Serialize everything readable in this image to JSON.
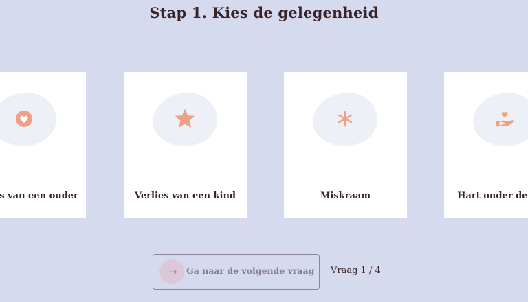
{
  "header": {
    "title": "Stap 1. Kies de gelegenheid"
  },
  "options": [
    {
      "label": "Verlies van een ouder",
      "icon": "heart-circle-icon"
    },
    {
      "label": "Verlies van een kind",
      "icon": "star-icon"
    },
    {
      "label": "Miskraam",
      "icon": "asterisk-icon"
    },
    {
      "label": "Hart onder de riem",
      "icon": "heart-hand-icon"
    }
  ],
  "footer": {
    "next_label": "Ga naar de volgende vraag",
    "progress": "Vraag 1 / 4"
  },
  "colors": {
    "background": "#d6daef",
    "card": "#ffffff",
    "icon_accent": "#f0a184",
    "text": "#3a2326"
  }
}
